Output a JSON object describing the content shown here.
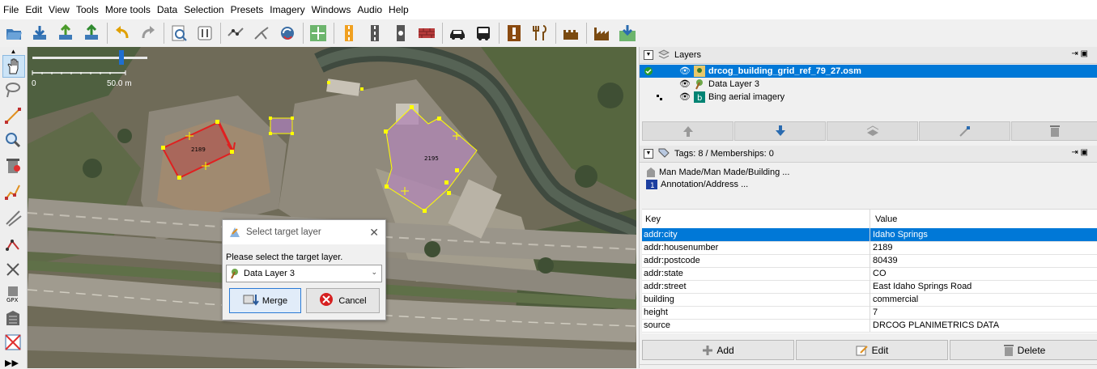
{
  "menu": [
    "File",
    "Edit",
    "View",
    "Tools",
    "More tools",
    "Data",
    "Selection",
    "Presets",
    "Imagery",
    "Windows",
    "Audio",
    "Help"
  ],
  "toolbar_icons": [
    "open-file-icon",
    "download-icon",
    "upload-icon",
    "save-icon",
    "undo-icon",
    "redo-icon",
    "search-icon",
    "preferences-icon",
    "wireframe-icon",
    "split-icon",
    "refresh-icon",
    "zoom-fit-icon",
    "road-marking-icon",
    "road-icon",
    "gate-icon",
    "wall-icon",
    "car-icon",
    "bus-icon",
    "warning-icon",
    "restaurant-icon",
    "castle-icon",
    "industry-icon",
    "download-area-icon"
  ],
  "map": {
    "scale_zero": "0",
    "scale_label": "50.0 m",
    "building_a_label": "2189",
    "building_b_label": "2195"
  },
  "dialog": {
    "title": "Select target layer",
    "prompt": "Please select the target layer.",
    "selected_layer": "Data Layer 3",
    "merge_label": "Merge",
    "cancel_label": "Cancel"
  },
  "layers_panel": {
    "title": "Layers",
    "layers": [
      {
        "name": "drcog_building_grid_ref_79_27.osm",
        "active": true
      },
      {
        "name": "Data Layer 3",
        "active": false
      },
      {
        "name": "Bing aerial imagery",
        "active": false
      }
    ]
  },
  "tags_panel": {
    "title": "Tags: 8 / Memberships: 0",
    "presets": [
      "Man Made/Man Made/Building ...",
      "Annotation/Address ..."
    ],
    "key_header": "Key",
    "value_header": "Value",
    "rows": [
      {
        "key": "addr:city",
        "value": "Idaho Springs"
      },
      {
        "key": "addr:housenumber",
        "value": "2189"
      },
      {
        "key": "addr:postcode",
        "value": "80439"
      },
      {
        "key": "addr:state",
        "value": "CO"
      },
      {
        "key": "addr:street",
        "value": "East Idaho Springs Road"
      },
      {
        "key": "building",
        "value": "commercial"
      },
      {
        "key": "height",
        "value": "7"
      },
      {
        "key": "source",
        "value": "DRCOG PLANIMETRICS DATA"
      }
    ],
    "add_label": "Add",
    "edit_label": "Edit",
    "delete_label": "Delete"
  },
  "colors": {
    "selection": "#0078d7",
    "building_selected": "#e02020",
    "building_fill": "#b085b5",
    "node_yellow": "#ffff00"
  }
}
